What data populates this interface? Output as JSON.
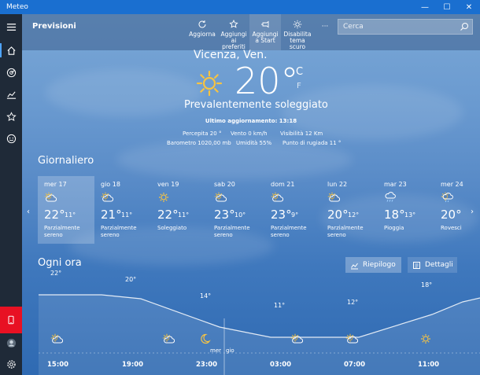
{
  "window": {
    "title": "Meteo",
    "minimize": "—",
    "maximize": "☐",
    "close": "✕"
  },
  "toolbar": {
    "section": "Previsioni",
    "refresh": "Aggiorna",
    "add_fav": "Aggiungi ai preferiti",
    "pin_start": "Aggiungi a Start",
    "dark_theme": "Disabilita tema scuro",
    "more": "···",
    "search_placeholder": "Cerca"
  },
  "current": {
    "location": "Vicenza, Ven.",
    "temp": "20°",
    "unit_c": "C",
    "unit_f": "F",
    "condition": "Prevalentemente soleggiato",
    "updated": "Ultimo aggiornamento: 13:18",
    "details": {
      "feels": "Percepita  20 °",
      "wind": "Vento   0 km/h",
      "visibility": "Visibilità  12 Km",
      "pressure": "Barometro  1020,00 mb",
      "humidity": "Umidità  55%",
      "dewpoint": "Punto di rugiada  11 °"
    }
  },
  "daily": {
    "title": "Giornaliero",
    "days": [
      {
        "name": "mer 17",
        "hi": "22°",
        "lo": "11°",
        "cond": "Parzialmente sereno",
        "icon": "partly-cloudy-icon"
      },
      {
        "name": "gio 18",
        "hi": "21°",
        "lo": "11°",
        "cond": "Parzialmente sereno",
        "icon": "partly-cloudy-icon"
      },
      {
        "name": "ven 19",
        "hi": "22°",
        "lo": "11°",
        "cond": "Soleggiato",
        "icon": "sunny-icon"
      },
      {
        "name": "sab 20",
        "hi": "23°",
        "lo": "10°",
        "cond": "Parzialmente sereno",
        "icon": "partly-cloudy-icon"
      },
      {
        "name": "dom 21",
        "hi": "23°",
        "lo": "9°",
        "cond": "Parzialmente sereno",
        "icon": "partly-cloudy-icon"
      },
      {
        "name": "lun 22",
        "hi": "20°",
        "lo": "12°",
        "cond": "Parzialmente sereno",
        "icon": "partly-cloudy-icon"
      },
      {
        "name": "mar 23",
        "hi": "18°",
        "lo": "13°",
        "cond": "Pioggia",
        "icon": "rain-icon"
      },
      {
        "name": "mer 24",
        "hi": "20°",
        "lo": "",
        "cond": "Rovesci",
        "icon": "showers-icon"
      }
    ]
  },
  "hourly": {
    "title": "Ogni ora",
    "summary_btn": "Riepilogo",
    "details_btn": "Dettagli",
    "temps": [
      "22°",
      "20°",
      "14°",
      "11°",
      "12°",
      "18°"
    ],
    "times": [
      "15:00",
      "19:00",
      "23:00",
      "03:00",
      "07:00",
      "11:00"
    ],
    "day_left": "mer",
    "day_right": "gio",
    "icons": [
      "partly-cloudy-icon",
      "partly-cloudy-icon",
      "moon-icon",
      "partly-cloudy-icon",
      "partly-cloudy-icon",
      "sunny-icon"
    ]
  }
}
